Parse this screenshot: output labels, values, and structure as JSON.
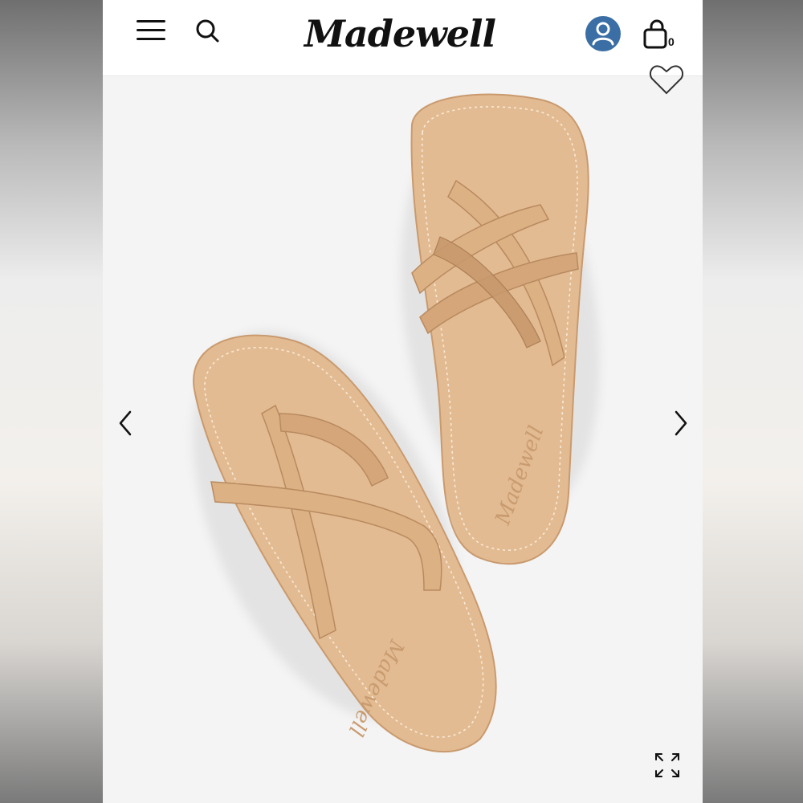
{
  "brand": {
    "logo_text": "Madewell"
  },
  "header": {
    "menu_icon": "hamburger-menu-icon",
    "search_icon": "search-icon",
    "account_icon": "account-icon",
    "bag_icon": "shopping-bag-icon",
    "bag_count": "0",
    "account_color": "#3a6ea5"
  },
  "product": {
    "image": "tan leather strappy thong sandals",
    "sole_imprint": "Madewell",
    "leather_color": "#e2b88d",
    "prev_icon": "chevron-left-icon",
    "next_icon": "chevron-right-icon",
    "favorite_icon": "heart-icon",
    "expand_icon": "expand-icon"
  }
}
